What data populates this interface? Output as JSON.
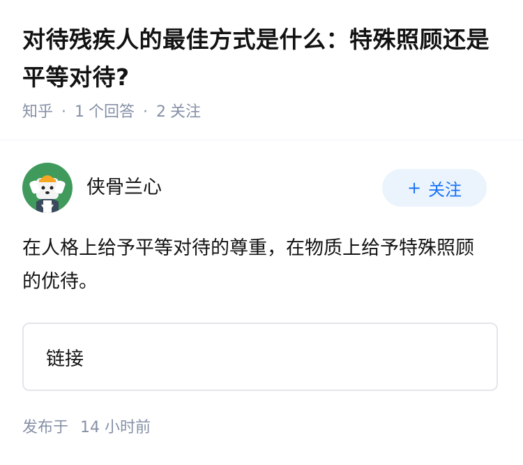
{
  "question": {
    "title": "对待残疾人的最佳方式是什么：特殊照顾还是平等对待?",
    "source": "知乎",
    "answer_count": "1",
    "answer_label": "个回答",
    "follow_count": "2",
    "follow_label": "关注"
  },
  "author": {
    "name": "侠骨兰心",
    "follow_button_label": "关注",
    "avatar_icon": "cartoon-dog-avatar-icon",
    "avatar_bg": "#3f9a5c"
  },
  "answer": {
    "text": "在人格上给予平等对待的尊重，在物质上给予特殊照顾的优待。"
  },
  "link_card": {
    "label": "链接"
  },
  "footer": {
    "published_prefix": "发布于",
    "published_time": "14 小时前"
  },
  "colors": {
    "text": "#121212",
    "meta": "#8590a6",
    "accent": "#1772f6",
    "follow_bg": "#ebf4fd",
    "card_border": "#e3e5ea"
  }
}
